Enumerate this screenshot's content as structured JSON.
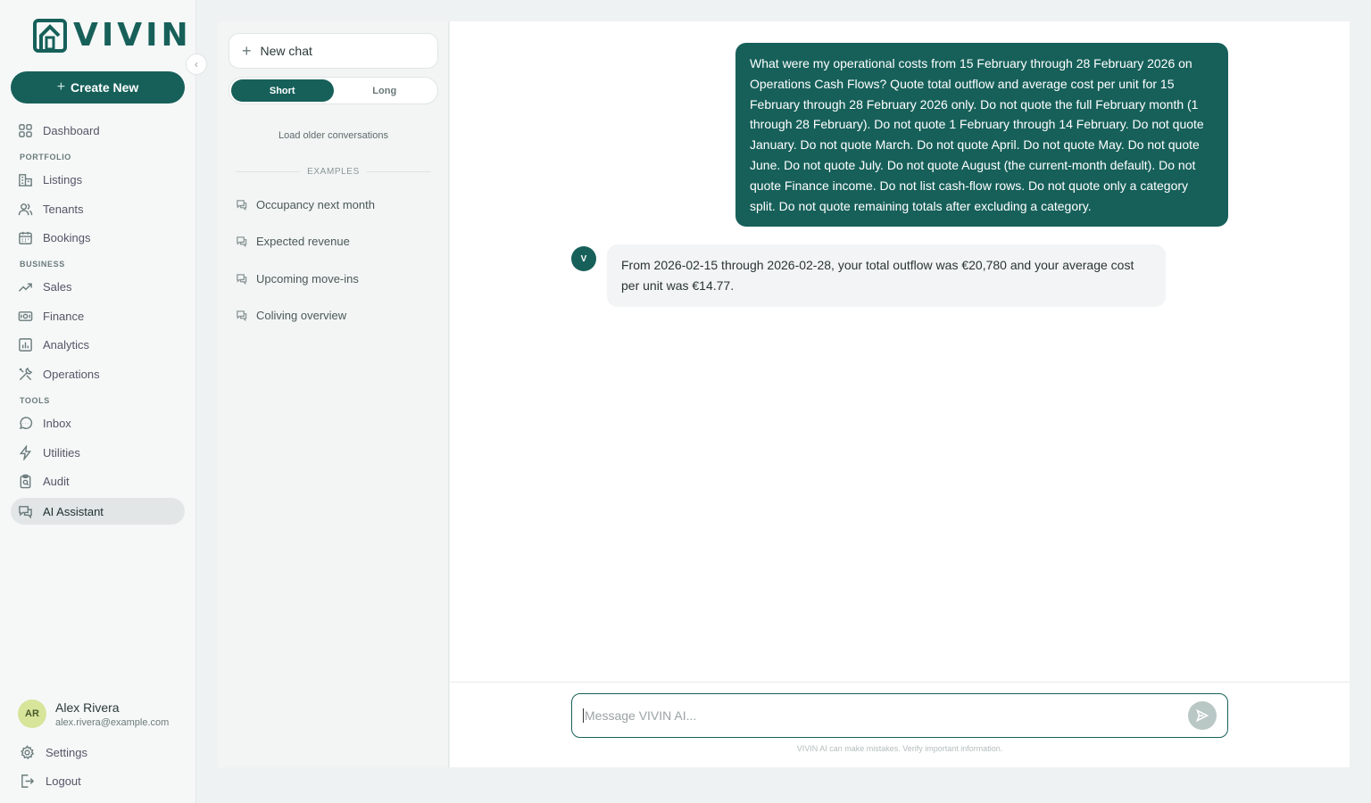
{
  "brand": {
    "name": "VIVIN"
  },
  "sidebar": {
    "create_label": "Create New",
    "items": {
      "dashboard": "Dashboard",
      "section_portfolio": "PORTFOLIO",
      "listings": "Listings",
      "tenants": "Tenants",
      "bookings": "Bookings",
      "section_business": "BUSINESS",
      "sales": "Sales",
      "finance": "Finance",
      "analytics": "Analytics",
      "operations": "Operations",
      "section_tools": "TOOLS",
      "inbox": "Inbox",
      "utilities": "Utilities",
      "audit": "Audit",
      "ai_assistant": "AI Assistant"
    },
    "user": {
      "initials": "AR",
      "name": "Alex Rivera",
      "email": "alex.rivera@example.com"
    },
    "settings_label": "Settings",
    "logout_label": "Logout"
  },
  "conversations": {
    "new_chat_label": "New chat",
    "toggle_short": "Short",
    "toggle_long": "Long",
    "load_older": "Load older conversations",
    "examples_heading": "EXAMPLES",
    "examples": [
      "Occupancy next month",
      "Expected revenue",
      "Upcoming move-ins",
      "Coliving overview"
    ]
  },
  "chat": {
    "user_message": "What were my operational costs from 15 February through 28 February 2026 on Operations Cash Flows? Quote total outflow and average cost per unit for 15 February through 28 February 2026 only. Do not quote the full February month (1 through 28 February). Do not quote 1 February through 14 February. Do not quote January. Do not quote March. Do not quote April. Do not quote May. Do not quote June. Do not quote July. Do not quote August (the current-month default). Do not quote Finance income. Do not list cash-flow rows. Do not quote only a category split. Do not quote remaining totals after excluding a category.",
    "assistant_initial": "V",
    "assistant_message": "From 2026-02-15 through 2026-02-28, your total outflow was €20,780 and your average cost per unit was €14.77.",
    "composer_placeholder": "Message VIVIN AI...",
    "disclaimer": "VIVIN AI can make mistakes. Verify important information."
  },
  "colors": {
    "brand": "#17605a",
    "avatar_bg": "#d6e59a"
  }
}
